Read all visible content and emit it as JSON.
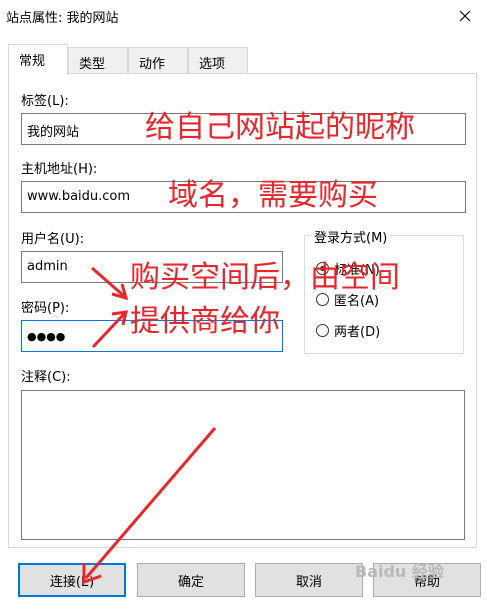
{
  "window": {
    "title": "站点属性: 我的网站"
  },
  "tabs": [
    {
      "label": "常规"
    },
    {
      "label": "类型"
    },
    {
      "label": "动作"
    },
    {
      "label": "选项"
    }
  ],
  "form": {
    "label_label": "标签(L):",
    "label_value": "我的网站",
    "host_label": "主机地址(H):",
    "host_value": "www.baidu.com",
    "user_label": "用户名(U):",
    "user_value": "admin",
    "password_label": "密码(P):",
    "password_value": "●●●●",
    "notes_label": "注释(C):"
  },
  "login_mode": {
    "title": "登录方式(M)",
    "options": [
      {
        "label": "标准(N)",
        "selected": true
      },
      {
        "label": "匿名(A)",
        "selected": false
      },
      {
        "label": "两者(D)",
        "selected": false
      }
    ]
  },
  "buttons": {
    "connect": "连接(E)",
    "ok": "确定",
    "cancel": "取消",
    "help": "帮助"
  },
  "annotations": {
    "nickname": "给自己网站起的昵称",
    "domain": "域名，需要购买",
    "space_line1": "购买空间后，由空间",
    "space_line2": "提供商给你"
  },
  "watermark": "Baidu 经验",
  "colors": {
    "annotation": "#e8262c",
    "focus": "#0078d7"
  }
}
